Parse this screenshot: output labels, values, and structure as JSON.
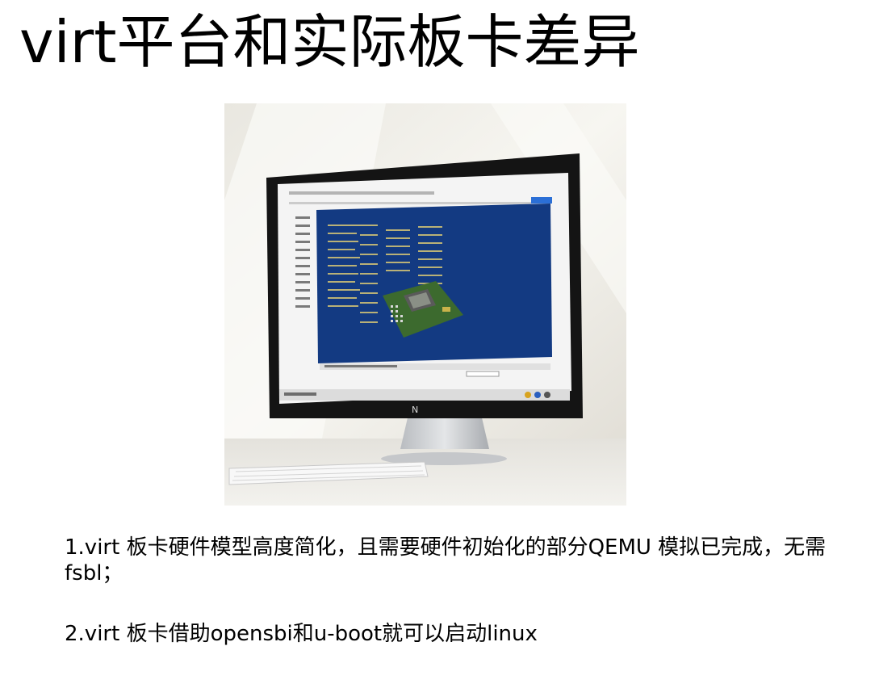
{
  "slide": {
    "title": "virt平台和实际板卡差异"
  },
  "image": {
    "subject": "monitor-with-emulator-window",
    "colors": {
      "background": "#f1efe9",
      "bezel": "#151515",
      "screen_blue": "#133a82",
      "board_green": "#3c6a2e"
    }
  },
  "bullets": [
    {
      "text": "1.virt 板卡硬件模型高度简化，且需要硬件初始化的部分QEMU 模拟已完成，无需fsbl；"
    },
    {
      "text": "2.virt 板卡借助opensbi和u-boot就可以启动linux"
    }
  ]
}
